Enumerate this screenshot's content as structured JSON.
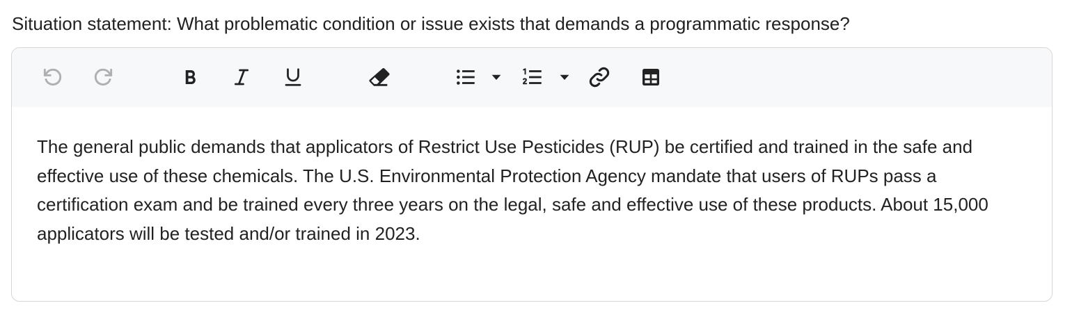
{
  "question": {
    "label": "Situation statement: What problematic condition or issue exists that demands a programmatic response?"
  },
  "toolbar": {
    "buttons": [
      {
        "name": "undo",
        "icon": "undo-icon",
        "enabled": false
      },
      {
        "name": "redo",
        "icon": "redo-icon",
        "enabled": false
      },
      {
        "name": "bold",
        "icon": "bold-icon",
        "enabled": true
      },
      {
        "name": "italic",
        "icon": "italic-icon",
        "enabled": true
      },
      {
        "name": "underline",
        "icon": "underline-icon",
        "enabled": true
      },
      {
        "name": "clear-formatting",
        "icon": "eraser-icon",
        "enabled": true
      },
      {
        "name": "bullet-list",
        "icon": "bullet-list-icon",
        "enabled": true
      },
      {
        "name": "bullet-list-options",
        "icon": "caret-down-icon",
        "enabled": true
      },
      {
        "name": "numbered-list",
        "icon": "numbered-list-icon",
        "enabled": true
      },
      {
        "name": "numbered-list-options",
        "icon": "caret-down-icon",
        "enabled": true
      },
      {
        "name": "link",
        "icon": "link-icon",
        "enabled": true
      },
      {
        "name": "table",
        "icon": "table-icon",
        "enabled": true
      }
    ]
  },
  "editor": {
    "content": "The general public demands that applicators of Restrict Use Pesticides (RUP) be certified and trained in the safe and effective use of these chemicals. The U.S. Environmental Protection Agency mandate that users of RUPs pass a certification exam and be trained every three years on the legal, safe and effective use of these products. About 15,000 applicators will be tested and/or trained in 2023."
  },
  "colors": {
    "icon": "#222222",
    "icon_disabled": "#b0b0b0",
    "toolbar_bg": "#f7f8f9",
    "border": "#d6d6d6"
  }
}
